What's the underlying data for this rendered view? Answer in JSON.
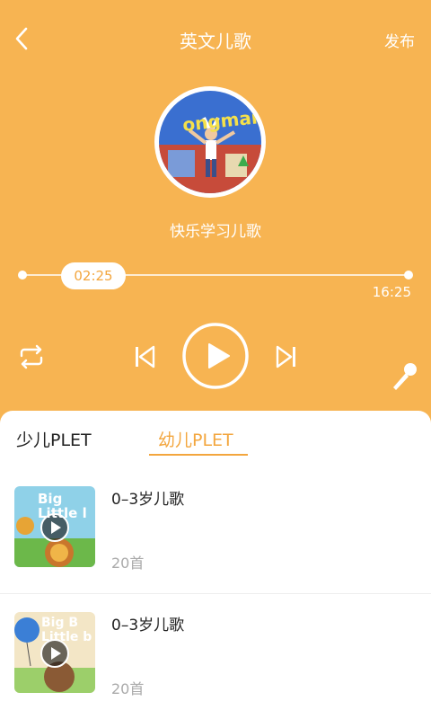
{
  "header": {
    "title": "英文儿歌",
    "publish_label": "发布"
  },
  "player": {
    "album_cover_text": "ongman Elect",
    "song_name": "快乐学习儿歌",
    "current_time": "02:25",
    "total_time": "16:25",
    "progress_fraction": 0.15
  },
  "tabs": [
    {
      "label": "少儿PLET",
      "active": false
    },
    {
      "label": "幼儿PLET",
      "active": true
    }
  ],
  "playlists": [
    {
      "title": "0–3岁儿歌",
      "count": "20首",
      "thumb_text": "Big Little l"
    },
    {
      "title": "0–3岁儿歌",
      "count": "20首",
      "thumb_text": "Big B Little b"
    }
  ],
  "colors": {
    "background": "#f7b452",
    "accent": "#f3a63e",
    "text_dark": "#222222",
    "text_muted": "#aaaaaa"
  }
}
